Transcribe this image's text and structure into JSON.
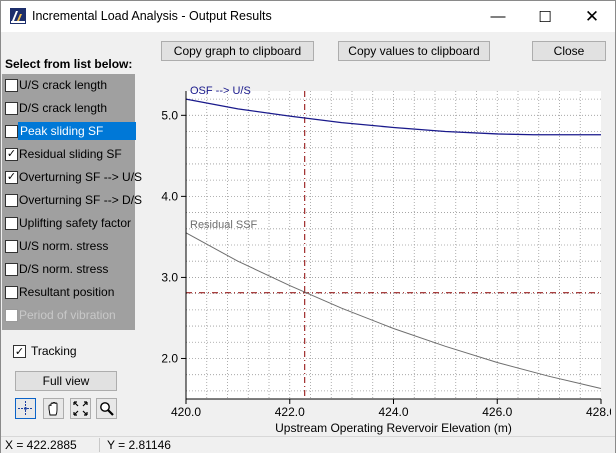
{
  "window": {
    "title": "Incremental Load Analysis - Output Results",
    "minimize_glyph": "—",
    "maximize_glyph": "☐",
    "close_glyph": "✕"
  },
  "toolbar": {
    "copy_graph": "Copy graph to clipboard",
    "copy_values": "Copy values to clipboard",
    "close": "Close"
  },
  "list": {
    "heading": "Select from list below:",
    "items": [
      {
        "label": "U/S crack length",
        "checked": false,
        "selected": false,
        "disabled": false
      },
      {
        "label": "D/S crack length",
        "checked": false,
        "selected": false,
        "disabled": false
      },
      {
        "label": "Peak sliding SF",
        "checked": false,
        "selected": true,
        "disabled": false
      },
      {
        "label": "Residual sliding SF",
        "checked": true,
        "selected": false,
        "disabled": false
      },
      {
        "label": "Overturning SF --> U/S",
        "checked": true,
        "selected": false,
        "disabled": false
      },
      {
        "label": "Overturning SF --> D/S",
        "checked": false,
        "selected": false,
        "disabled": false
      },
      {
        "label": "Uplifting safety factor",
        "checked": false,
        "selected": false,
        "disabled": false
      },
      {
        "label": "U/S norm. stress",
        "checked": false,
        "selected": false,
        "disabled": false
      },
      {
        "label": "D/S norm. stress",
        "checked": false,
        "selected": false,
        "disabled": false
      },
      {
        "label": "Resultant position",
        "checked": false,
        "selected": false,
        "disabled": false
      },
      {
        "label": "Period of vibration",
        "checked": false,
        "selected": false,
        "disabled": true
      }
    ]
  },
  "tracking": {
    "label": "Tracking",
    "checked": true
  },
  "full_view": "Full view",
  "tools": [
    "crosshair-icon",
    "pan-hand-icon",
    "fit-icon",
    "zoom-icon"
  ],
  "status": {
    "x_text": "X = 422.2885",
    "y_text": "Y =  2.81146"
  },
  "chart_data": {
    "type": "line",
    "xlabel": "Upstream Operating Revervoir Elevation (m)",
    "ylabel": "",
    "xlim": [
      420.0,
      428.0
    ],
    "ylim": [
      1.5,
      5.3
    ],
    "x_ticks": [
      420.0,
      422.0,
      424.0,
      426.0,
      428.0
    ],
    "x_tick_labels": [
      "420.0",
      "422.0",
      "424.0",
      "426.0",
      "428.0"
    ],
    "y_ticks": [
      2.0,
      3.0,
      4.0,
      5.0
    ],
    "y_tick_labels": [
      "2.0",
      "3.0",
      "4.0",
      "5.0"
    ],
    "x_minor_step": 0.4,
    "y_minor_step": 0.2,
    "grid": true,
    "crosshair": {
      "x": 422.2885,
      "y": 2.81146
    },
    "series": [
      {
        "name": "OSF --> U/S",
        "color": "#1a1a8c",
        "x": [
          420.0,
          421.0,
          422.0,
          423.0,
          424.0,
          425.0,
          426.0,
          426.7,
          428.0
        ],
        "y": [
          5.2,
          5.08,
          4.99,
          4.91,
          4.85,
          4.8,
          4.77,
          4.76,
          4.76
        ]
      },
      {
        "name": "Residual SSF",
        "color": "#6e6e6e",
        "x": [
          420.0,
          421.0,
          422.0,
          423.0,
          424.0,
          425.0,
          426.0,
          427.0,
          428.0
        ],
        "y": [
          3.55,
          3.2,
          2.9,
          2.62,
          2.37,
          2.15,
          1.95,
          1.78,
          1.63
        ]
      }
    ],
    "colors": {
      "grid": "#9a9a9a",
      "crosshair": "#8b0000",
      "axis": "#000000"
    }
  }
}
